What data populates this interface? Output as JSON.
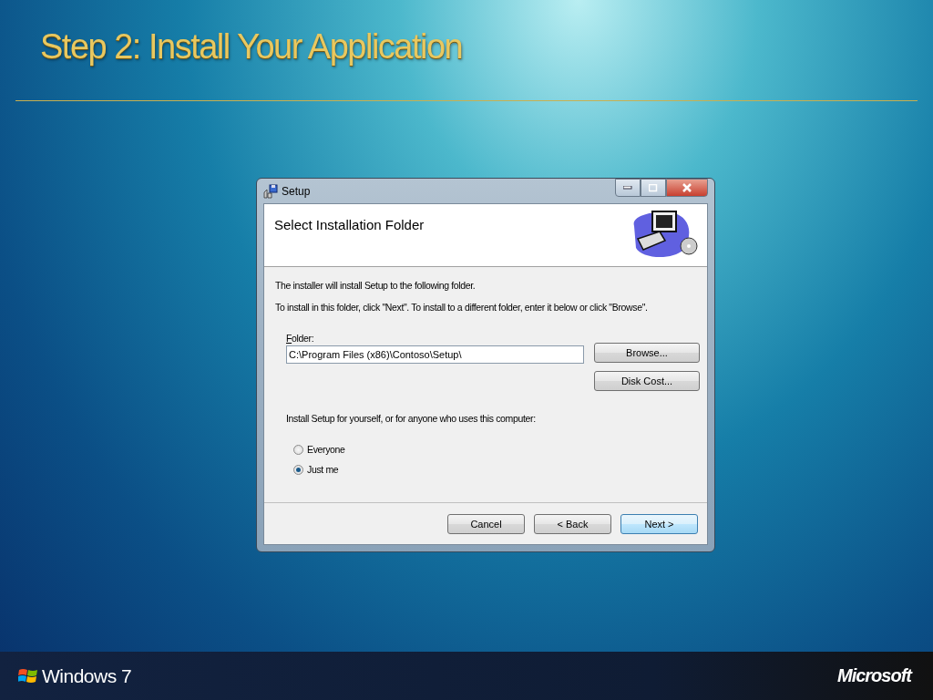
{
  "slide": {
    "title": "Step 2: Install Your Application"
  },
  "window": {
    "title": "Setup"
  },
  "header": {
    "title": "Select Installation Folder"
  },
  "intro": [
    "The installer will install Setup to the following folder.",
    "To install in this folder, click \"Next\". To install to a different folder, enter it below or click \"Browse\"."
  ],
  "folder": {
    "label": "Folder:",
    "value": "C:\\Program Files (x86)\\Contoso\\Setup\\"
  },
  "side_buttons": [
    "Browse...",
    "Disk Cost..."
  ],
  "scope": {
    "prompt": "Install Setup for yourself, or for anyone who uses this computer:",
    "options": [
      {
        "label": "Everyone",
        "selected": false
      },
      {
        "label": "Just me",
        "selected": true
      }
    ]
  },
  "buttons": [
    {
      "label": "Cancel",
      "default": false
    },
    {
      "label": "< Back",
      "default": false
    },
    {
      "label": "Next >",
      "default": true
    }
  ],
  "footer": {
    "product": "Windows 7",
    "brand": "Microsoft"
  }
}
